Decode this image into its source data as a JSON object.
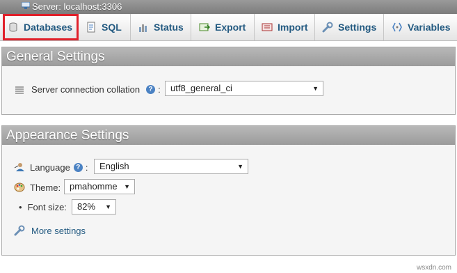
{
  "server": {
    "label": "Server: localhost:3306",
    "icon": "server-icon"
  },
  "tabs": [
    {
      "label": "Databases",
      "icon": "database-icon"
    },
    {
      "label": "SQL",
      "icon": "sql-icon"
    },
    {
      "label": "Status",
      "icon": "status-icon"
    },
    {
      "label": "Export",
      "icon": "export-icon"
    },
    {
      "label": "Import",
      "icon": "import-icon"
    },
    {
      "label": "Settings",
      "icon": "wrench-icon"
    },
    {
      "label": "Variables",
      "icon": "variables-icon"
    }
  ],
  "highlight_color": "#e0202a",
  "general": {
    "title": "General Settings",
    "collation_label": "Server connection collation",
    "collation_value": "utf8_general_ci"
  },
  "appearance": {
    "title": "Appearance Settings",
    "language_label": "Language",
    "language_value": "English",
    "theme_label": "Theme:",
    "theme_value": "pmahomme",
    "fontsize_label": "Font size:",
    "fontsize_value": "82%",
    "more_settings": "More settings"
  },
  "help_glyph": "?",
  "colon": ":",
  "bullet": "•",
  "footer": "wsxdn.com"
}
